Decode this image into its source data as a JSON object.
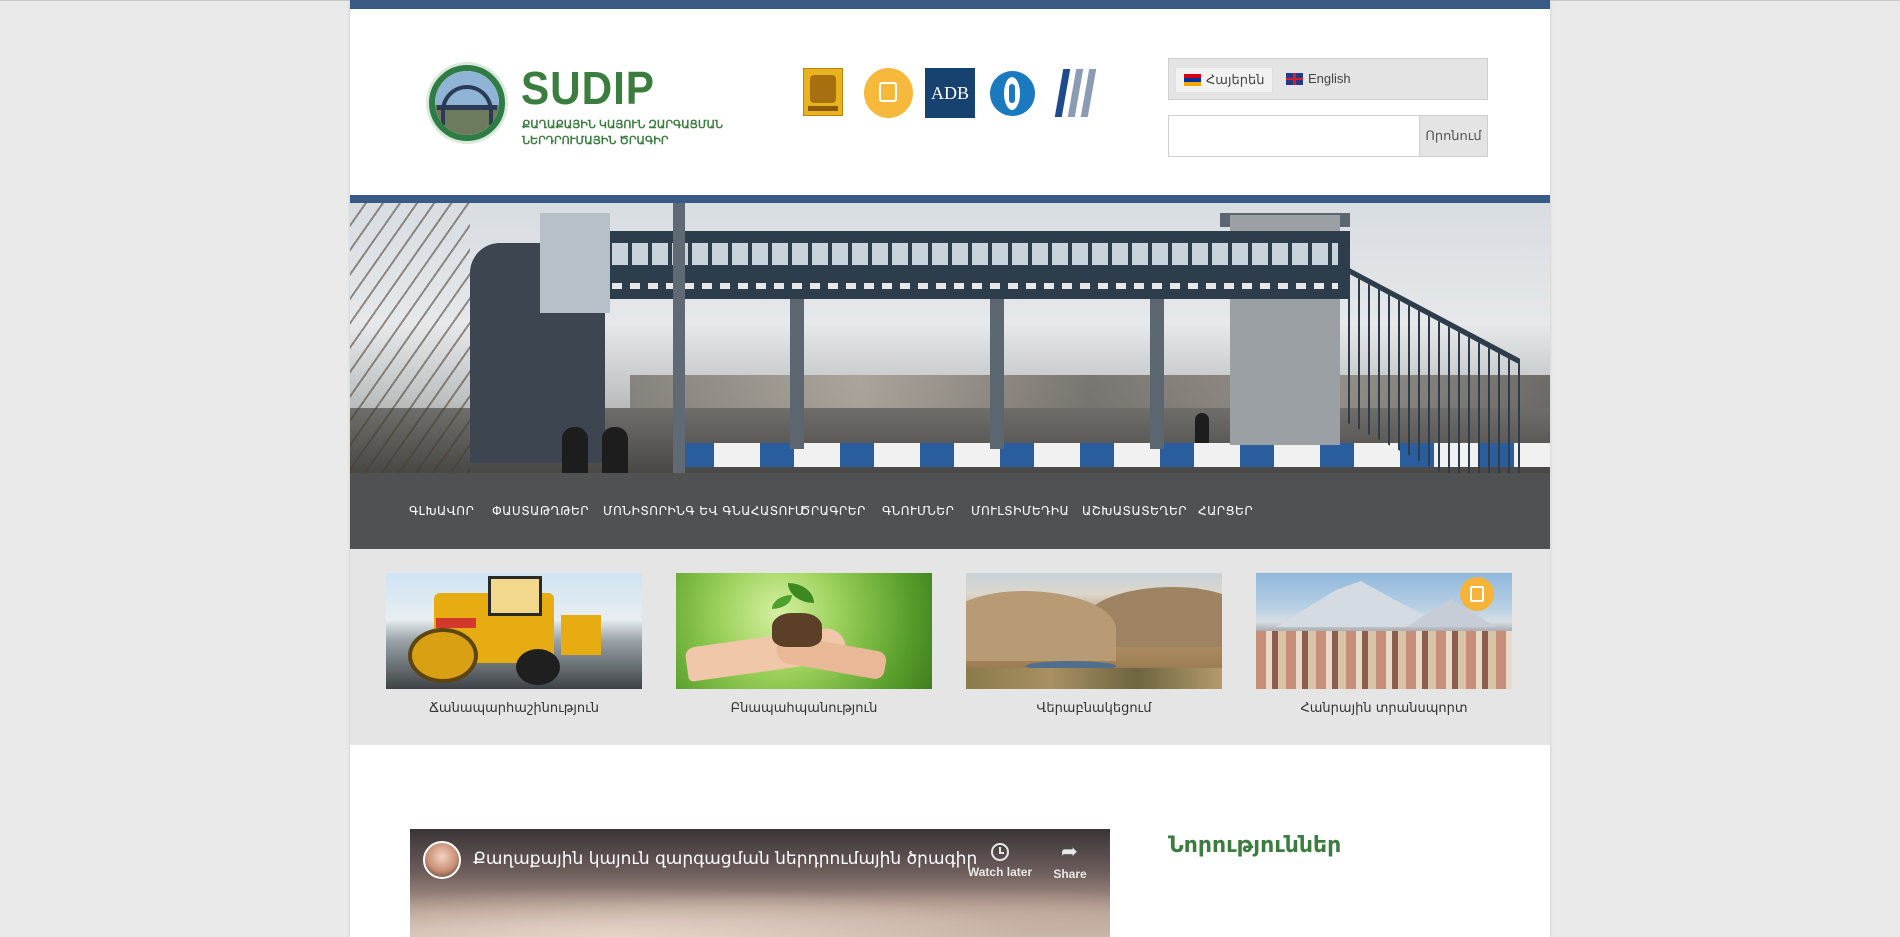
{
  "header": {
    "logo_title": "SUDIP",
    "logo_subtitle": "ՔԱՂԱՔԱՅԻՆ ԿԱՅՈՒՆ ԶԱՐԳԱՑՄԱՆ ՆԵՐԴՐՈՒՄԱՅԻՆ ԾՐԱԳԻՐ",
    "partners": [
      {
        "name": "yerevan-municipality-logo"
      },
      {
        "name": "public-transport-logo"
      },
      {
        "name": "adb-logo",
        "text": "ADB"
      },
      {
        "name": "eib-logo"
      },
      {
        "name": "eu-logo"
      }
    ],
    "languages": [
      {
        "label": "Հայերեն",
        "flag": "armenia-flag"
      },
      {
        "label": "English",
        "flag": "uk-flag"
      }
    ],
    "search": {
      "placeholder": "",
      "button": "Որոնում"
    }
  },
  "nav": {
    "items": [
      "ԳԼԽԱՎՈՐ",
      "ՓԱՍՏԱԹՂԹԵՐ",
      "ՄՈՆԻՏՈՐԻՆԳ ԵՎ ԳՆԱՀԱՏՈՒՄ",
      "ԾՐԱԳՐԵՐ",
      "ԳՆՈՒՄՆԵՐ",
      "ՄՈՒԼՏԻՄԵԴԻԱ",
      "ԱՇԽԱՏԱՏԵՂԵՐ",
      "ՀԱՐՑԵՐ"
    ]
  },
  "categories": [
    {
      "label": "Ճանապարհաշինություն"
    },
    {
      "label": "Բնապահպանություն"
    },
    {
      "label": "Վերաբնակեցում"
    },
    {
      "label": "Հանրային տրանսպորտ"
    }
  ],
  "video": {
    "title": "Քաղաքային կայուն զարգացման ներդրումային ծրագիր",
    "watch_later": "Watch later",
    "share": "Share"
  },
  "news": {
    "title": "Նորություններ"
  },
  "colors": {
    "accent_blue": "#3a5a86",
    "brand_green": "#3b7d3f",
    "nav_bg": "#4f5153"
  }
}
